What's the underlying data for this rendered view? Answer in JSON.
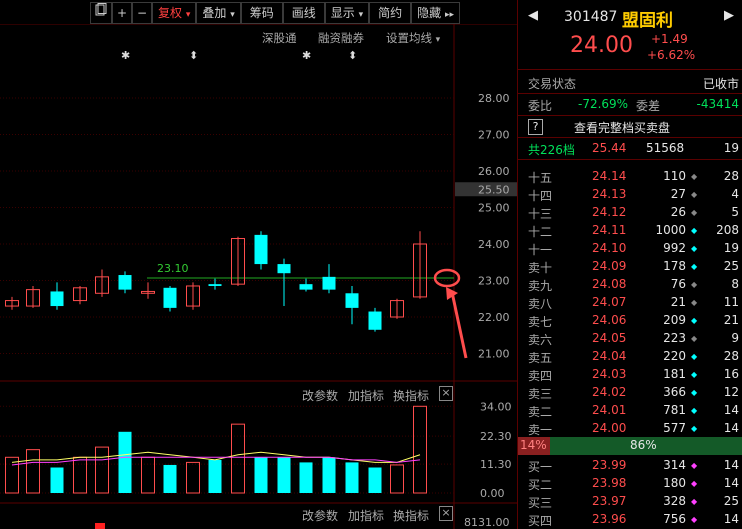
{
  "toolbar": {
    "items": [
      "复权",
      "叠加",
      "筹码",
      "画线",
      "显示",
      "简约",
      "隐藏"
    ],
    "plus": "+",
    "minus": "−",
    "dropdown": "▾",
    "more": "▸▸"
  },
  "links": {
    "a": "深股通",
    "b": "融资融券",
    "c": "设置均线"
  },
  "markers": {
    "star": "✱",
    "updown": "⬍"
  },
  "price_axis": [
    "28.00",
    "27.00",
    "26.00",
    "25.50",
    "25.00",
    "24.00",
    "23.00",
    "22.00",
    "21.00"
  ],
  "reference_line_label": "23.10",
  "volume_axis": [
    "34.00",
    "22.30",
    "11.30",
    "0.00"
  ],
  "volume_header": {
    "change": "改参数",
    "add": "加指标",
    "swap": "换指标",
    "close": "×"
  },
  "bottom": {
    "number": "8131.00"
  },
  "stock": {
    "code": "301487",
    "name": "盟固利",
    "price": "24.00",
    "change": "+1.49",
    "change_pct": "+6.62%"
  },
  "status": {
    "label": "交易状态",
    "value": "已收市"
  },
  "ratio": {
    "label1": "委比",
    "value1": "-72.69%",
    "label2": "委差",
    "value2": "-43414"
  },
  "full_book": {
    "icon": "?",
    "label": "查看完整档买卖盘"
  },
  "total": {
    "label": "共226档",
    "price": "25.44",
    "qty": "51568",
    "count": "19"
  },
  "asks": [
    {
      "label": "十五",
      "price": "24.14",
      "qty": "110",
      "dot": "gray",
      "count": "28"
    },
    {
      "label": "十四",
      "price": "24.13",
      "qty": "27",
      "dot": "gray",
      "count": "4"
    },
    {
      "label": "十三",
      "price": "24.12",
      "qty": "26",
      "dot": "gray",
      "count": "5"
    },
    {
      "label": "十二",
      "price": "24.11",
      "qty": "1000",
      "dot": "cyan",
      "count": "208"
    },
    {
      "label": "十一",
      "price": "24.10",
      "qty": "992",
      "dot": "cyan",
      "count": "19"
    },
    {
      "label": "卖十",
      "price": "24.09",
      "qty": "178",
      "dot": "cyan",
      "count": "25"
    },
    {
      "label": "卖九",
      "price": "24.08",
      "qty": "76",
      "dot": "gray",
      "count": "8"
    },
    {
      "label": "卖八",
      "price": "24.07",
      "qty": "21",
      "dot": "gray",
      "count": "11"
    },
    {
      "label": "卖七",
      "price": "24.06",
      "qty": "209",
      "dot": "cyan",
      "count": "21"
    },
    {
      "label": "卖六",
      "price": "24.05",
      "qty": "223",
      "dot": "gray",
      "count": "9"
    },
    {
      "label": "卖五",
      "price": "24.04",
      "qty": "220",
      "dot": "cyan",
      "count": "28"
    },
    {
      "label": "卖四",
      "price": "24.03",
      "qty": "181",
      "dot": "cyan",
      "count": "16"
    },
    {
      "label": "卖三",
      "price": "24.02",
      "qty": "366",
      "dot": "cyan",
      "count": "12"
    },
    {
      "label": "卖二",
      "price": "24.01",
      "qty": "781",
      "dot": "cyan",
      "count": "14"
    },
    {
      "label": "卖一",
      "price": "24.00",
      "qty": "577",
      "dot": "cyan",
      "count": "14"
    }
  ],
  "bar": {
    "left_pct": "14%",
    "right_pct": "86%",
    "left_value": 14
  },
  "bids": [
    {
      "label": "买一",
      "price": "23.99",
      "qty": "314",
      "dot": "mag",
      "count": "14"
    },
    {
      "label": "买二",
      "price": "23.98",
      "qty": "180",
      "dot": "mag",
      "count": "14"
    },
    {
      "label": "买三",
      "price": "23.97",
      "qty": "328",
      "dot": "mag",
      "count": "25"
    },
    {
      "label": "买四",
      "price": "23.96",
      "qty": "756",
      "dot": "mag",
      "count": "14"
    }
  ],
  "colors": {
    "up": "#ff4d4d",
    "down": "#00ffff",
    "ma": "#ffff66",
    "annotation": "#ff4d4d"
  }
}
